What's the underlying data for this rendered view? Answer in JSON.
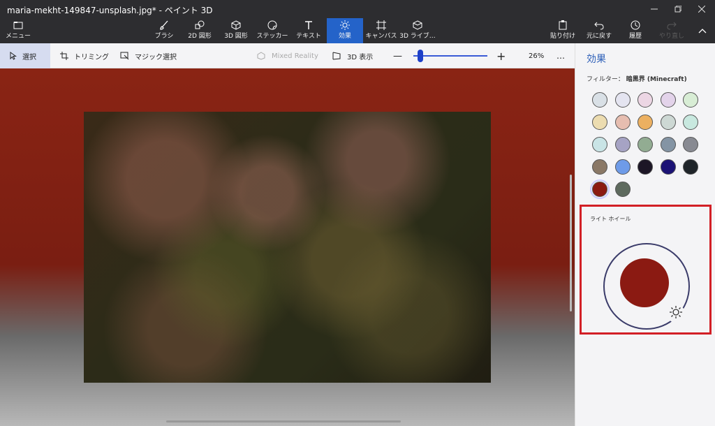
{
  "window": {
    "title": "maria-mekht-149847-unsplash.jpg* - ペイント 3D"
  },
  "ribbon": {
    "menu_label": "メニュー",
    "tools": [
      {
        "label": "ブラシ",
        "icon": "brush-icon"
      },
      {
        "label": "2D 図形",
        "icon": "shapes-2d-icon"
      },
      {
        "label": "3D 図形",
        "icon": "cube-icon"
      },
      {
        "label": "ステッカー",
        "icon": "sticker-icon"
      },
      {
        "label": "テキスト",
        "icon": "text-icon"
      },
      {
        "label": "効果",
        "icon": "sun-icon"
      },
      {
        "label": "キャンバス",
        "icon": "canvas-icon"
      },
      {
        "label": "3D ライブ…",
        "icon": "library-3d-icon"
      }
    ],
    "active_tool": "効果",
    "right_actions": [
      {
        "label": "貼り付け",
        "icon": "paste-icon"
      },
      {
        "label": "元に戻す",
        "icon": "undo-icon"
      },
      {
        "label": "履歴",
        "icon": "history-icon"
      },
      {
        "label": "やり直し",
        "icon": "redo-icon",
        "disabled": true
      }
    ]
  },
  "toolbar": {
    "select_label": "選択",
    "crop_label": "トリミング",
    "magic_select_label": "マジック選択",
    "mixed_reality_label": "Mixed Reality",
    "view3d_label": "3D 表示",
    "zoom_minus": "—",
    "zoom_plus": "+",
    "zoom_value": "26%",
    "zoom_level": 0.08,
    "more": "…"
  },
  "panel": {
    "title": "効果",
    "filter_prefix": "フィルター：",
    "filter_name": "暗黒界 (Minecraft)",
    "swatch_colors": [
      "#d9e0e6",
      "#e4e4f0",
      "#ecd6e4",
      "#e3d3ea",
      "#d8edd5",
      "#ecdcb0",
      "#e6bdb0",
      "#ecb061",
      "#cdd8d4",
      "#c8e8df",
      "#c9e4e6",
      "#a6a3c4",
      "#92ac92",
      "#8494a4",
      "#888a92",
      "#8a7866",
      "#6e9be8",
      "#1c1626",
      "#1b1275",
      "#1f2429",
      "#8b1a12",
      "#5e6a5e"
    ],
    "selected_swatch": 20,
    "light_wheel_label": "ライト ホイール",
    "light_color": "#8b1a12"
  }
}
